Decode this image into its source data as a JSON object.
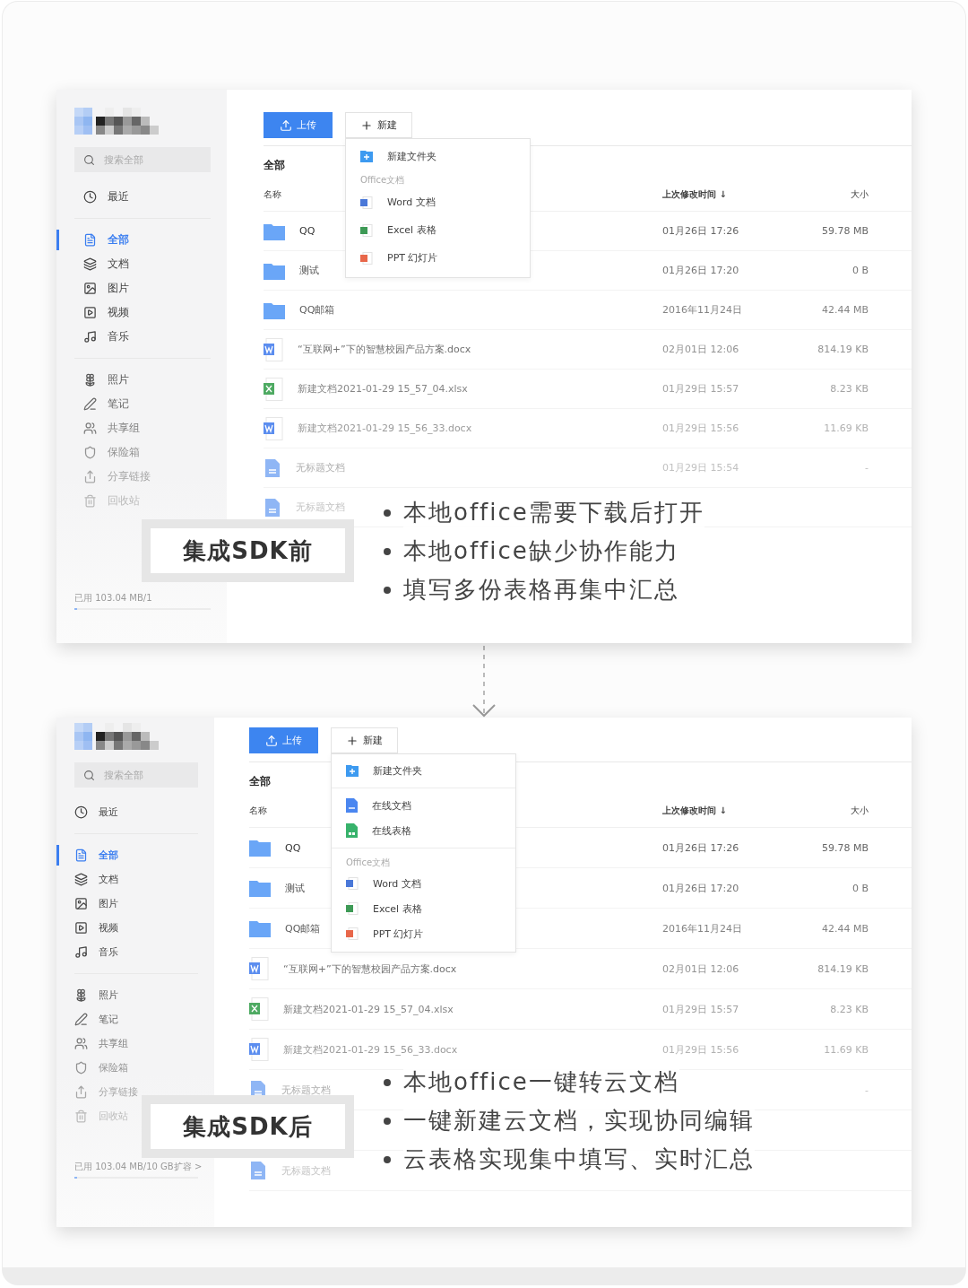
{
  "panels": [
    {
      "sidebar": {
        "search": {
          "placeholder": "搜索全部"
        },
        "groups": [
          [
            {
              "kind": "recent",
              "label": "最近",
              "selected": false
            }
          ],
          [
            {
              "kind": "all",
              "label": "全部",
              "selected": true
            },
            {
              "kind": "docs",
              "label": "文档",
              "selected": false
            },
            {
              "kind": "images",
              "label": "图片",
              "selected": false
            },
            {
              "kind": "video",
              "label": "视频",
              "selected": false
            },
            {
              "kind": "music",
              "label": "音乐",
              "selected": false
            }
          ],
          [
            {
              "kind": "photos",
              "label": "照片",
              "selected": false
            },
            {
              "kind": "notes",
              "label": "笔记",
              "selected": false
            },
            {
              "kind": "groups",
              "label": "共享组",
              "selected": false
            },
            {
              "kind": "safe",
              "label": "保险箱",
              "selected": false
            },
            {
              "kind": "share",
              "label": "分享链接",
              "selected": false
            },
            {
              "kind": "trash",
              "label": "回收站",
              "selected": false
            }
          ]
        ],
        "storage": {
          "usage": "已用 103.04 MB/1",
          "level": 0.02
        }
      },
      "toolbar": {
        "upload": "上传",
        "new": "新建"
      },
      "menu": [
        {
          "kind": "new-folder",
          "label": "新建文件夹"
        },
        {
          "kind": "section",
          "label": "Office文档"
        },
        {
          "kind": "word",
          "label": "Word 文档"
        },
        {
          "kind": "excel",
          "label": "Excel 表格"
        },
        {
          "kind": "ppt",
          "label": "PPT 幻灯片"
        }
      ],
      "heading": "全部",
      "columns": [
        "名称",
        "上次修改时间 ↓",
        "大小"
      ],
      "rows": [
        {
          "kind": "folder",
          "name": "QQ",
          "modified": "01月26日 17:26",
          "size": "59.78 MB"
        },
        {
          "kind": "folder",
          "name": "测试",
          "modified": "01月26日 17:20",
          "size": "0 B"
        },
        {
          "kind": "folder",
          "name": "QQ邮箱",
          "modified": "2016年11月24日",
          "size": "42.44 MB"
        },
        {
          "kind": "word",
          "name": "“互联网+”下的智慧校园产品方案.docx",
          "modified": "02月01日 12:06",
          "size": "814.19 KB"
        },
        {
          "kind": "excel",
          "name": "新建文档2021-01-29 15_57_04.xlsx",
          "modified": "01月29日 15:57",
          "size": "8.23 KB"
        },
        {
          "kind": "word",
          "name": "新建文档2021-01-29 15_56_33.docx",
          "modified": "01月29日 15:56",
          "size": "11.69 KB"
        },
        {
          "kind": "doc",
          "name": "无标题文档",
          "modified": "01月29日 15:54",
          "size": "-"
        },
        {
          "kind": "doc",
          "name": "无标题文档"
        }
      ],
      "label": "集成SDK前",
      "bullets": [
        "本地office需要下载后打开",
        "本地office缺少协作能力",
        "填写多份表格再集中汇总"
      ]
    },
    {
      "sidebar": {
        "search": {
          "placeholder": "搜索全部"
        },
        "groups": [
          [
            {
              "kind": "recent",
              "label": "最近",
              "selected": false
            }
          ],
          [
            {
              "kind": "all",
              "label": "全部",
              "selected": true
            },
            {
              "kind": "docs",
              "label": "文档",
              "selected": false
            },
            {
              "kind": "images",
              "label": "图片",
              "selected": false
            },
            {
              "kind": "video",
              "label": "视频",
              "selected": false
            },
            {
              "kind": "music",
              "label": "音乐",
              "selected": false
            }
          ],
          [
            {
              "kind": "photos",
              "label": "照片",
              "selected": false
            },
            {
              "kind": "notes",
              "label": "笔记",
              "selected": false
            },
            {
              "kind": "groups",
              "label": "共享组",
              "selected": false
            },
            {
              "kind": "safe",
              "label": "保险箱",
              "selected": false
            },
            {
              "kind": "share",
              "label": "分享链接",
              "selected": false
            },
            {
              "kind": "trash",
              "label": "回收站",
              "selected": false
            }
          ]
        ],
        "storage": {
          "usage": "已用 103.04 MB/10 GB",
          "expand": "扩容 >",
          "level": 0.02
        }
      },
      "toolbar": {
        "upload": "上传",
        "new": "新建"
      },
      "menu": [
        {
          "kind": "new-folder",
          "label": "新建文件夹"
        },
        {
          "kind": "divider"
        },
        {
          "kind": "online-doc",
          "label": "在线文档"
        },
        {
          "kind": "online-sheet",
          "label": "在线表格"
        },
        {
          "kind": "divider"
        },
        {
          "kind": "section",
          "label": "Office文档"
        },
        {
          "kind": "word",
          "label": "Word 文档"
        },
        {
          "kind": "excel",
          "label": "Excel 表格"
        },
        {
          "kind": "ppt",
          "label": "PPT 幻灯片"
        }
      ],
      "heading": "全部",
      "columns": [
        "名称",
        "上次修改时间 ↓",
        "大小"
      ],
      "rows": [
        {
          "kind": "folder",
          "name": "QQ",
          "modified": "01月26日 17:26",
          "size": "59.78 MB"
        },
        {
          "kind": "folder",
          "name": "测试",
          "modified": "01月26日 17:20",
          "size": "0 B"
        },
        {
          "kind": "folder",
          "name": "QQ邮箱",
          "modified": "2016年11月24日",
          "size": "42.44 MB"
        },
        {
          "kind": "word",
          "name": "“互联网+”下的智慧校园产品方案.docx",
          "modified": "02月01日 12:06",
          "size": "814.19 KB"
        },
        {
          "kind": "excel",
          "name": "新建文档2021-01-29 15_57_04.xlsx",
          "modified": "01月29日 15:57",
          "size": "8.23 KB"
        },
        {
          "kind": "word",
          "name": "新建文档2021-01-29 15_56_33.docx",
          "modified": "01月29日 15:56",
          "size": "11.69 KB"
        },
        {
          "kind": "doc",
          "name": "无标题文档",
          "size": "-"
        },
        {
          "kind": "doc",
          "name": "无标题文档"
        }
      ],
      "label": "集成SDK后",
      "bullets": [
        "本地office一键转云文档",
        "一键新建云文档，实现协同编辑",
        "云表格实现集中填写、实时汇总"
      ]
    }
  ]
}
